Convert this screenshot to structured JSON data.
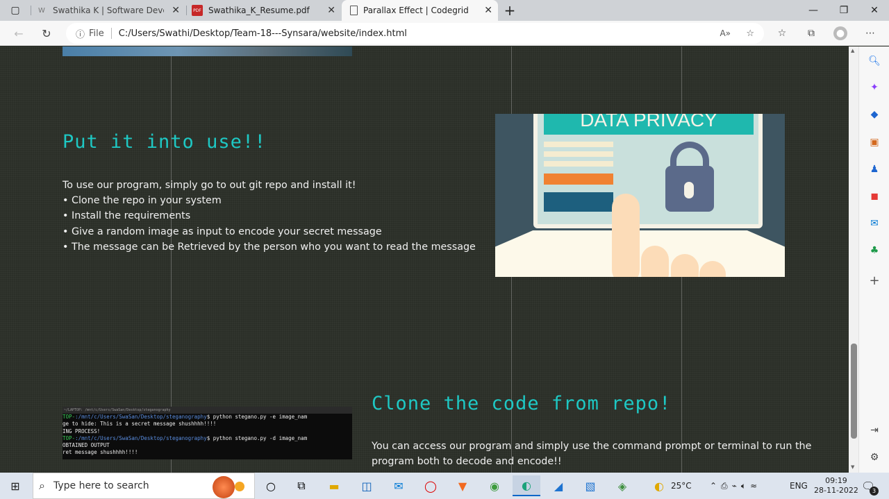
{
  "browser": {
    "tabs": [
      {
        "label": "Swathika K | Software Developer",
        "favicon": "W"
      },
      {
        "label": "Swathika_K_Resume.pdf",
        "favicon": "PDF"
      },
      {
        "label": "Parallax Effect | Codegrid",
        "favicon": "page-icon"
      }
    ],
    "new_tab": "+",
    "address": {
      "file_label": "File",
      "url": "C:/Users/Swathi/Desktop/Team-18---Synsara/website/index.html"
    }
  },
  "page": {
    "section1": {
      "heading": "Put it into use!!",
      "lines": [
        "To use our program, simply go to out git repo and install it!",
        "• Clone the repo in your system",
        "• Install the requirements",
        "• Give a random image as input to encode your secret message",
        "• The message can be Retrieved by the person who you want to read the message"
      ],
      "image_banner": "DATA PRIVACY"
    },
    "section2": {
      "heading": "Clone the code from repo!",
      "lines": [
        "You can access our program and simply use the command prompt or terminal to run the",
        "program both to decode and encode!!"
      ],
      "terminal": {
        "title": "~/LAPTOP: /mnt/c/Users/SwaSan/Desktop/steganography",
        "rows": [
          {
            "prefix": "TOP-",
            "path": ":/mnt/c/Users/SwaSan/Desktop/steganography",
            "cmd": "$ python stegano.py -e image_nam"
          },
          {
            "text": "ge to hide: This is a secret message shushhhh!!!!"
          },
          {
            "text": "ING PROCESS!"
          },
          {
            "prefix": "TOP-",
            "path": ":/mnt/c/Users/SwaSan/Desktop/steganography",
            "cmd": "$ python stegano.py -d image_nam"
          },
          {
            "text": "OBTAINED OUTPUT"
          },
          {
            "text": "ret message shushhhh!!!!"
          }
        ]
      }
    }
  },
  "taskbar": {
    "search_placeholder": "Type here to search",
    "weather": "25°C",
    "language": "ENG",
    "time": "09:19",
    "date": "28-11-2022",
    "notifications": "3"
  }
}
